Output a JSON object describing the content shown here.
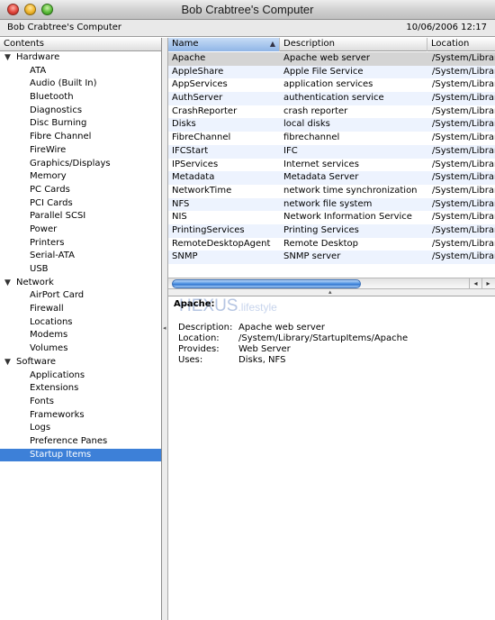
{
  "window": {
    "title": "Bob Crabtree's Computer",
    "computer_name": "Bob Crabtree's Computer",
    "datetime": "10/06/2006 12:17"
  },
  "sidebar": {
    "header": "Contents",
    "groups": [
      {
        "label": "Hardware",
        "items": [
          "ATA",
          "Audio (Built In)",
          "Bluetooth",
          "Diagnostics",
          "Disc Burning",
          "Fibre Channel",
          "FireWire",
          "Graphics/Displays",
          "Memory",
          "PC Cards",
          "PCI Cards",
          "Parallel SCSI",
          "Power",
          "Printers",
          "Serial-ATA",
          "USB"
        ]
      },
      {
        "label": "Network",
        "items": [
          "AirPort Card",
          "Firewall",
          "Locations",
          "Modems",
          "Volumes"
        ]
      },
      {
        "label": "Software",
        "items": [
          "Applications",
          "Extensions",
          "Fonts",
          "Frameworks",
          "Logs",
          "Preference Panes",
          "Startup Items"
        ]
      }
    ],
    "selected": "Startup Items"
  },
  "table": {
    "columns": [
      "Name",
      "Description",
      "Location"
    ],
    "sorted_column": "Name",
    "rows": [
      [
        "Apache",
        "Apache web server",
        "/System/Librar"
      ],
      [
        "AppleShare",
        "Apple File Service",
        "/System/Librar"
      ],
      [
        "AppServices",
        "application services",
        "/System/Librar"
      ],
      [
        "AuthServer",
        "authentication service",
        "/System/Librar"
      ],
      [
        "CrashReporter",
        "crash reporter",
        "/System/Librar"
      ],
      [
        "Disks",
        "local disks",
        "/System/Librar"
      ],
      [
        "FibreChannel",
        "fibrechannel",
        "/System/Librar"
      ],
      [
        "IFCStart",
        "IFC",
        "/System/Librar"
      ],
      [
        "IPServices",
        "Internet services",
        "/System/Librar"
      ],
      [
        "Metadata",
        "Metadata Server",
        "/System/Librar"
      ],
      [
        "NetworkTime",
        "network time synchronization",
        "/System/Librar"
      ],
      [
        "NFS",
        "network file system",
        "/System/Librar"
      ],
      [
        "NIS",
        "Network Information Service",
        "/System/Librar"
      ],
      [
        "PrintingServices",
        "Printing Services",
        "/System/Librar"
      ],
      [
        "RemoteDesktopAgent",
        "Remote Desktop",
        "/System/Librar"
      ],
      [
        "SNMP",
        "SNMP server",
        "/System/Librar"
      ]
    ],
    "selected_row": 0
  },
  "detail": {
    "title": "Apache:",
    "fields": [
      {
        "key": "Description:",
        "value": "Apache web server"
      },
      {
        "key": "Location:",
        "value": "/System/Library/StartupItems/Apache"
      },
      {
        "key": "Provides:",
        "value": "Web Server"
      },
      {
        "key": "Uses:",
        "value": "Disks, NFS"
      }
    ],
    "watermark_main": "HEXUS",
    "watermark_sub": ".lifestyle"
  },
  "colors": {
    "selection": "#3d80d8",
    "alt_row": "#edf3fe",
    "selected_row": "#d4d4d4"
  }
}
